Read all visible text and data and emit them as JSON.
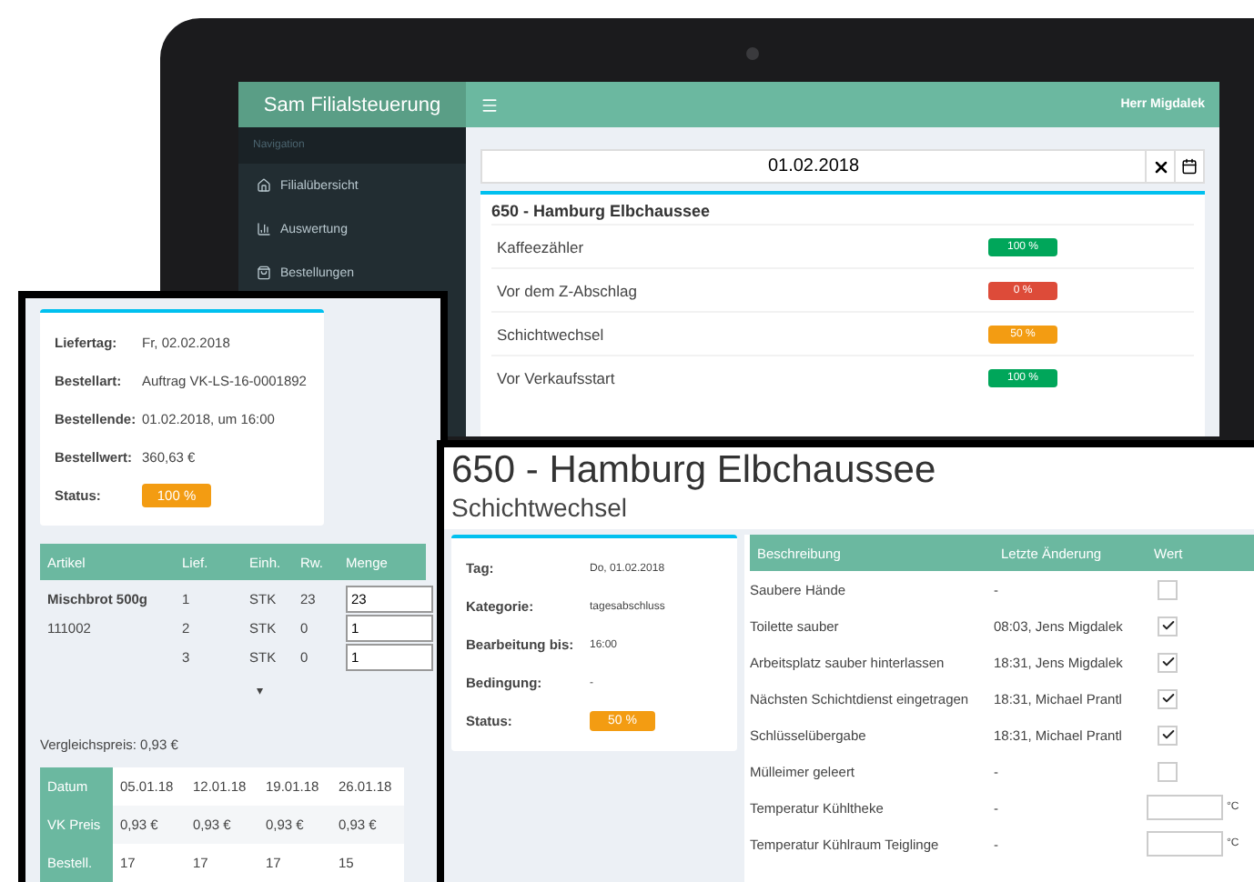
{
  "tablet": {
    "brand": "Sam Filialsteuerung",
    "nav_heading": "Navigation",
    "nav_items": [
      {
        "label": "Filialübersicht"
      },
      {
        "label": "Auswertung"
      },
      {
        "label": "Bestellungen"
      }
    ],
    "user": "Herr Migdalek",
    "date": "01.02.2018",
    "card_title": "650 - Hamburg Elbchaussee",
    "rows": [
      {
        "label": "Kaffeezähler",
        "badge": "100 %",
        "color": "#00a65a"
      },
      {
        "label": "Vor dem Z-Abschlag",
        "badge": "0 %",
        "color": "#dd4b39"
      },
      {
        "label": "Schichtwechsel",
        "badge": "50 %",
        "color": "#f39c12"
      },
      {
        "label": "Vor Verkaufsstart",
        "badge": "100 %",
        "color": "#00a65a"
      }
    ]
  },
  "order_panel": {
    "fields": [
      {
        "label": "Liefertag:",
        "value": "Fr, 02.02.2018"
      },
      {
        "label": "Bestellart:",
        "value": "Auftrag VK-LS-16-0001892"
      },
      {
        "label": "Bestellende:",
        "value": "01.02.2018, um 16:00"
      },
      {
        "label": "Bestellwert:",
        "value": "360,63 €"
      }
    ],
    "status": {
      "label": "Status:",
      "badge": "100 %",
      "color": "#f39c12"
    },
    "columns": [
      "Artikel",
      "Lief.",
      "Einh.",
      "Rw.",
      "Menge"
    ],
    "article": {
      "name": "Mischbrot 500g",
      "number": "111002",
      "lines": [
        {
          "lief": "1",
          "unit": "STK",
          "rw": "23",
          "amount": "23"
        },
        {
          "lief": "2",
          "unit": "STK",
          "rw": "0",
          "amount": "1"
        },
        {
          "lief": "3",
          "unit": "STK",
          "rw": "0",
          "amount": "1"
        }
      ]
    },
    "expand": "▾",
    "comparison": "Vergleichspreis: 0,93 €",
    "history": [
      {
        "head": "Datum",
        "cells": [
          "05.01.18",
          "12.01.18",
          "19.01.18",
          "26.01.18"
        ]
      },
      {
        "head": "VK Preis",
        "cells": [
          "0,93 €",
          "0,93 €",
          "0,93 €",
          "0,93 €"
        ]
      },
      {
        "head": "Bestell.",
        "cells": [
          "17",
          "17",
          "17",
          "15"
        ]
      }
    ]
  },
  "shift_panel": {
    "title": "650 - Hamburg Elbchaussee",
    "subtitle": "Schichtwechsel",
    "fields": [
      {
        "label": "Tag:",
        "value": "Do, 01.02.2018"
      },
      {
        "label": "Kategorie:",
        "value": "tagesabschluss"
      },
      {
        "label": "Bearbeitung bis:",
        "value": "16:00"
      },
      {
        "label": "Bedingung:",
        "value": "-"
      }
    ],
    "status": {
      "label": "Status:",
      "badge": "50 %",
      "color": "#f39c12"
    },
    "columns": [
      "Beschreibung",
      "Letzte Änderung",
      "Wert"
    ],
    "tasks": [
      {
        "kind": "checkbox",
        "label": "Saubere Hände",
        "changed": "-",
        "checked": false
      },
      {
        "kind": "checkbox",
        "label": "Toilette sauber",
        "changed": "08:03, Jens Migdalek",
        "checked": true
      },
      {
        "kind": "checkbox",
        "label": "Arbeitsplatz sauber hinterlassen",
        "changed": "18:31, Jens Migdalek",
        "checked": true
      },
      {
        "kind": "checkbox",
        "label": "Nächsten Schichtdienst eingetragen",
        "changed": "18:31, Michael Prantl",
        "checked": true
      },
      {
        "kind": "checkbox",
        "label": "Schlüsselübergabe",
        "changed": "18:31, Michael Prantl",
        "checked": true
      },
      {
        "kind": "checkbox",
        "label": "Mülleimer geleert",
        "changed": "-",
        "checked": false
      },
      {
        "kind": "temperature",
        "label": "Temperatur Kühltheke",
        "changed": "-",
        "unit": "°C"
      },
      {
        "kind": "temperature",
        "label": "Temperatur Kühlraum Teiglinge",
        "changed": "-",
        "unit": "°C"
      }
    ]
  }
}
